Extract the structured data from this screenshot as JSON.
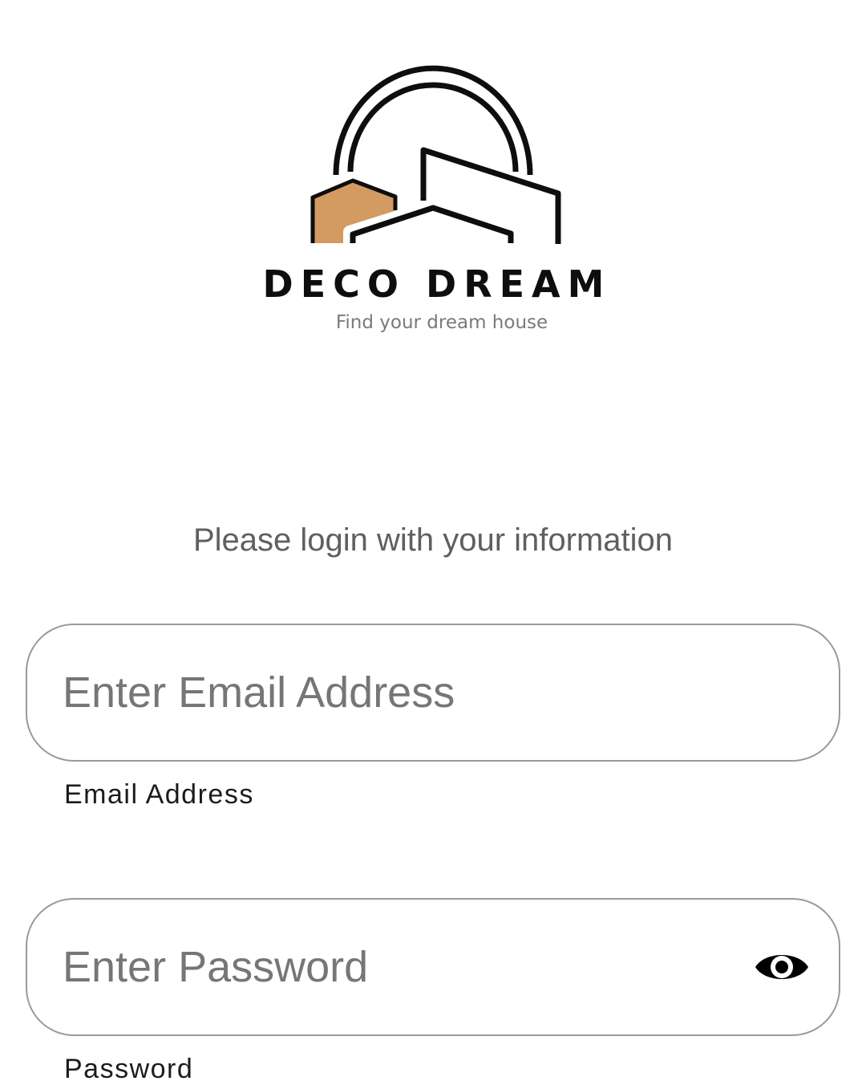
{
  "brand": {
    "name": "DECO DREAM",
    "tagline": "Find your dream house",
    "accent_color": "#d39a62"
  },
  "login": {
    "instruction": "Please login with your information",
    "email": {
      "placeholder": "Enter Email Address",
      "value": "",
      "label": "Email Address"
    },
    "password": {
      "placeholder": "Enter Password",
      "value": "",
      "label": "Password",
      "toggle_icon": "eye-icon"
    }
  }
}
